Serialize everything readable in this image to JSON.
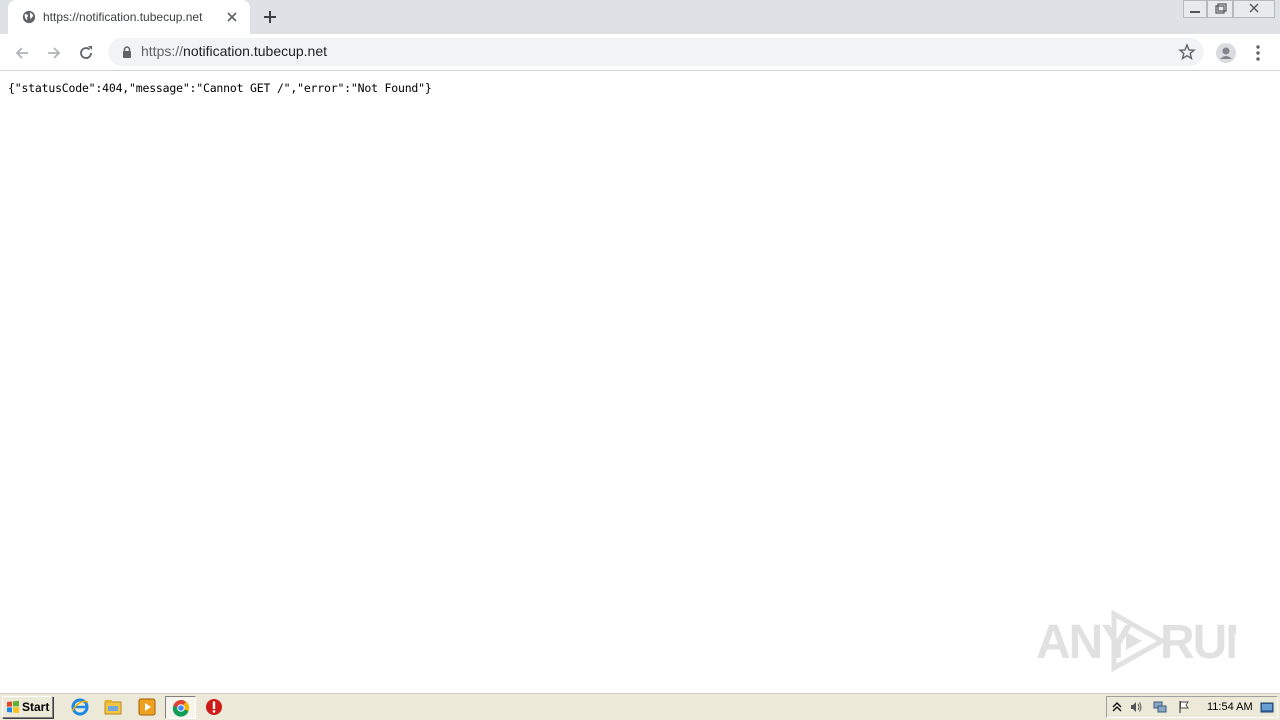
{
  "browser": {
    "tab": {
      "title": "https://notification.tubecup.net",
      "favicon": "globe-icon"
    },
    "omnibox": {
      "scheme": "https://",
      "host": "notification.tubecup.net"
    }
  },
  "page": {
    "body_text": "{\"statusCode\":404,\"message\":\"Cannot GET /\",\"error\":\"Not Found\"}"
  },
  "watermark": {
    "text_left": "ANY",
    "text_right": "RUN"
  },
  "taskbar": {
    "start_label": "Start",
    "clock": "11:54 AM",
    "pinned": [
      "internet-explorer-icon",
      "file-explorer-icon",
      "media-player-icon",
      "chrome-icon",
      "stop-icon"
    ]
  },
  "colors": {
    "tabstrip_bg": "#dee1e6",
    "omnibox_bg": "#f1f3f4",
    "taskbar_bg": "#ece9d8"
  }
}
